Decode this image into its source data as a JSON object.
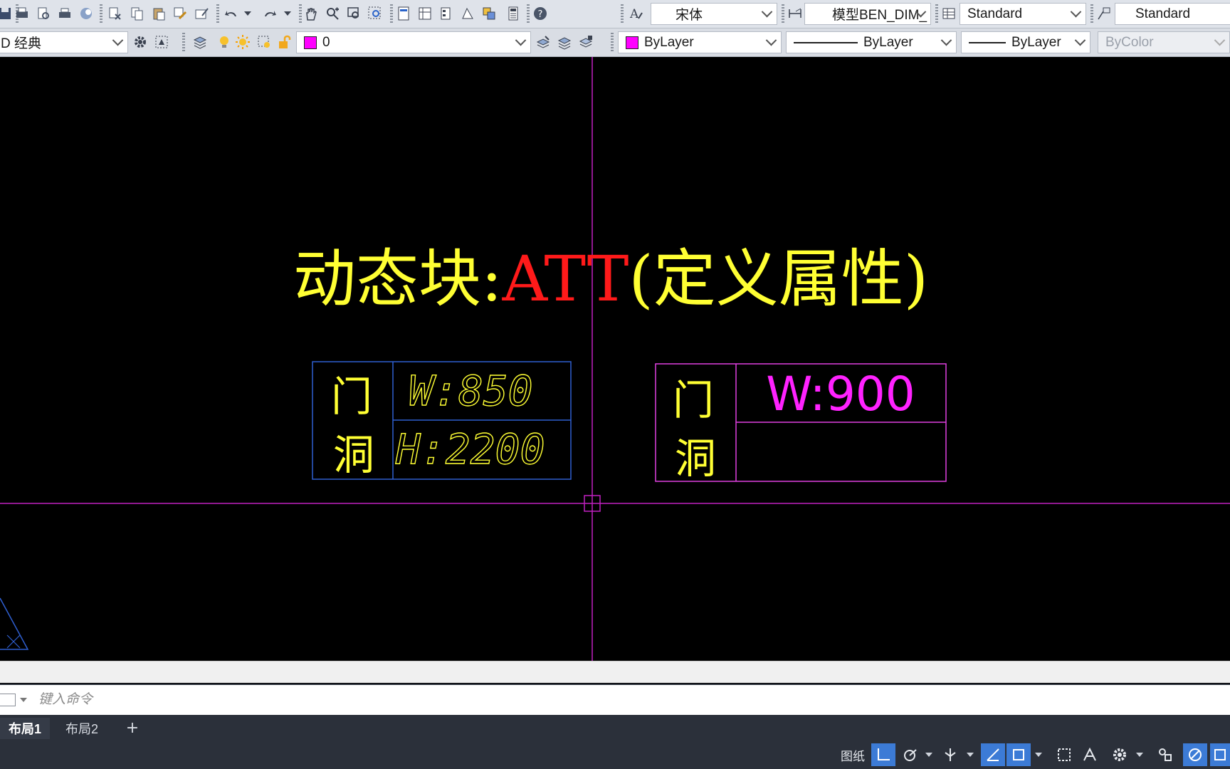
{
  "toolbar1": {
    "text_style": "宋体",
    "dim_style": "模型BEN_DIM_",
    "table_style": "Standard",
    "multileader_style": "Standard"
  },
  "toolbar2": {
    "workspace": "D 经典",
    "layer_name": "0",
    "layer_color": "#ff00ff",
    "color": "ByLayer",
    "linetype": "ByLayer",
    "lineweight": "ByLayer",
    "plot_style": "ByColor"
  },
  "drawing": {
    "title_part1": "动态块:",
    "title_part2": "ATT",
    "title_part3": "(定义属性)",
    "title_color": "#ffff33",
    "title_accent_color": "#ff1a1a",
    "block1": {
      "label_top": "门",
      "label_bottom": "洞",
      "width_value": "W:850",
      "height_value": "H:2200",
      "frame_color": "#2f5fd0",
      "text_color": "#ffff33"
    },
    "block2": {
      "label_top": "门",
      "label_bottom": "洞",
      "width_value": "W:900",
      "height_value": "",
      "frame_color": "#e040e0",
      "value_color": "#ff22ff",
      "label_color": "#ffff33"
    },
    "crosshair_color": "#c020c0"
  },
  "command": {
    "placeholder": "键入命令"
  },
  "layout_tabs": [
    {
      "label": "布局1",
      "active": true
    },
    {
      "label": "布局2",
      "active": false
    }
  ],
  "status": {
    "paper_space": "图纸"
  }
}
